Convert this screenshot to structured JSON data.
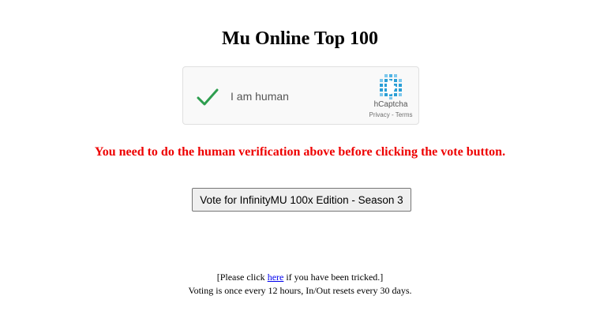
{
  "page": {
    "title": "Mu Online Top 100"
  },
  "captcha": {
    "label": "I am human",
    "brand": "hCaptcha",
    "privacy": "Privacy",
    "separator": " - ",
    "terms": "Terms",
    "check_color": "#2e9e4f",
    "logo_color": "#2a9fd6"
  },
  "warning": {
    "text": "You need to do the human verification above before clicking the vote button.",
    "color": "#ee0000"
  },
  "vote_button": {
    "label": "Vote for InfinityMU 100x Edition - Season 3"
  },
  "footer": {
    "line1_before": "[Please click ",
    "line1_link": "here",
    "line1_after": " if you have been tricked.]",
    "line2": "Voting is once every 12 hours, In/Out resets every 30 days."
  }
}
